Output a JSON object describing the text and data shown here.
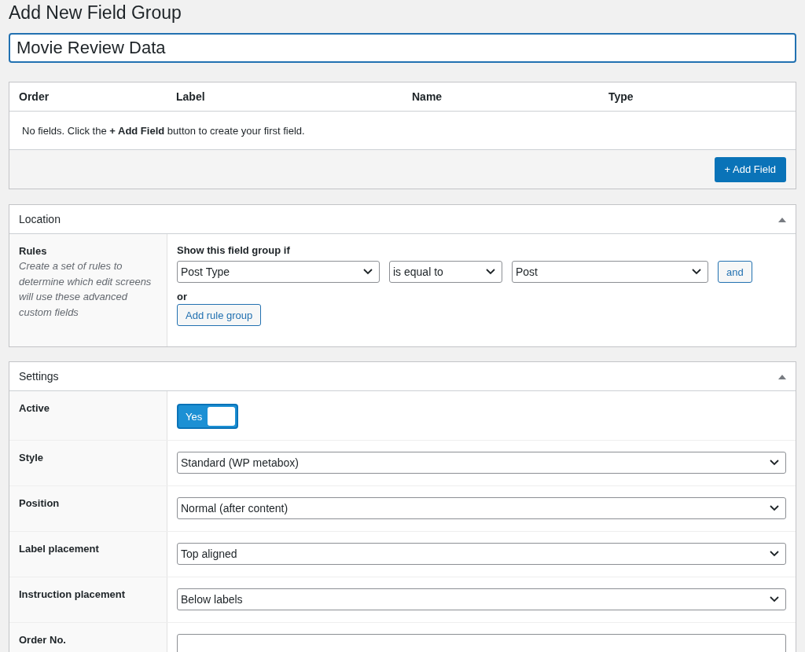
{
  "page_title": "Add New Field Group",
  "title_field": {
    "value": "Movie Review Data"
  },
  "fields_table": {
    "columns": [
      "Order",
      "Label",
      "Name",
      "Type"
    ],
    "empty_message": "No fields. Click the **+ Add Field** button to create your first field.",
    "add_button": "+ Add Field"
  },
  "location": {
    "title": "Location",
    "expanded": true,
    "label": "Rules",
    "description": "Create a set of rules to determine which edit screens will use these advanced custom fields",
    "heading": "Show this field group if",
    "rule": {
      "param": "Post Type",
      "operator": "is equal to",
      "value": "Post",
      "and_button": "and"
    },
    "or_label": "or",
    "add_group_button": "Add rule group"
  },
  "settings": {
    "title": "Settings",
    "expanded": true,
    "rows": [
      {
        "kind": "toggle",
        "label": "Active",
        "on": true,
        "text": "Yes"
      },
      {
        "kind": "select",
        "label": "Style",
        "value": "Standard (WP metabox)"
      },
      {
        "kind": "select",
        "label": "Position",
        "value": "Normal (after content)"
      },
      {
        "kind": "select",
        "label": "Label placement",
        "value": "Top aligned"
      },
      {
        "kind": "select",
        "label": "Instruction placement",
        "value": "Below labels"
      },
      {
        "kind": "input",
        "label": "Order No."
      }
    ]
  }
}
